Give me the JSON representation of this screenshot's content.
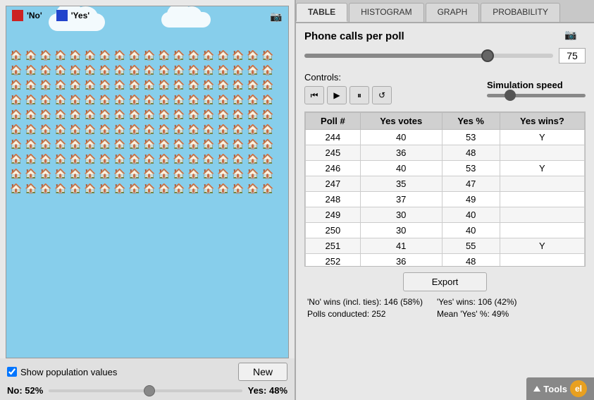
{
  "left_panel": {
    "legend": {
      "no_label": "'No'",
      "yes_label": "'Yes'"
    },
    "show_population_label": "Show population values",
    "new_button_label": "New",
    "no_label": "No: 52%",
    "yes_label": "Yes: 48%"
  },
  "right_panel": {
    "tabs": [
      {
        "label": "TABLE",
        "active": true
      },
      {
        "label": "HISTOGRAM",
        "active": false
      },
      {
        "label": "GRAPH",
        "active": false
      },
      {
        "label": "PROBABILITY",
        "active": false
      }
    ],
    "phone_calls_label": "Phone calls per poll",
    "phone_calls_value": "75",
    "controls_label": "Controls:",
    "sim_speed_label": "Simulation speed",
    "export_button_label": "Export",
    "table": {
      "headers": [
        "Poll #",
        "Yes votes",
        "Yes %",
        "Yes wins?"
      ],
      "rows": [
        {
          "poll": "244",
          "yes_votes": "40",
          "yes_pct": "53",
          "yes_wins": "Y"
        },
        {
          "poll": "245",
          "yes_votes": "36",
          "yes_pct": "48",
          "yes_wins": ""
        },
        {
          "poll": "246",
          "yes_votes": "40",
          "yes_pct": "53",
          "yes_wins": "Y"
        },
        {
          "poll": "247",
          "yes_votes": "35",
          "yes_pct": "47",
          "yes_wins": ""
        },
        {
          "poll": "248",
          "yes_votes": "37",
          "yes_pct": "49",
          "yes_wins": ""
        },
        {
          "poll": "249",
          "yes_votes": "30",
          "yes_pct": "40",
          "yes_wins": ""
        },
        {
          "poll": "250",
          "yes_votes": "30",
          "yes_pct": "40",
          "yes_wins": ""
        },
        {
          "poll": "251",
          "yes_votes": "41",
          "yes_pct": "55",
          "yes_wins": "Y"
        },
        {
          "poll": "252",
          "yes_votes": "36",
          "yes_pct": "48",
          "yes_wins": ""
        }
      ]
    },
    "stats": {
      "no_wins": "'No' wins (incl. ties): 146 (58%)",
      "yes_wins": "'Yes' wins: 106 (42%)",
      "polls_conducted": "Polls conducted: 252",
      "mean_yes": "Mean 'Yes' %: 49%"
    }
  }
}
